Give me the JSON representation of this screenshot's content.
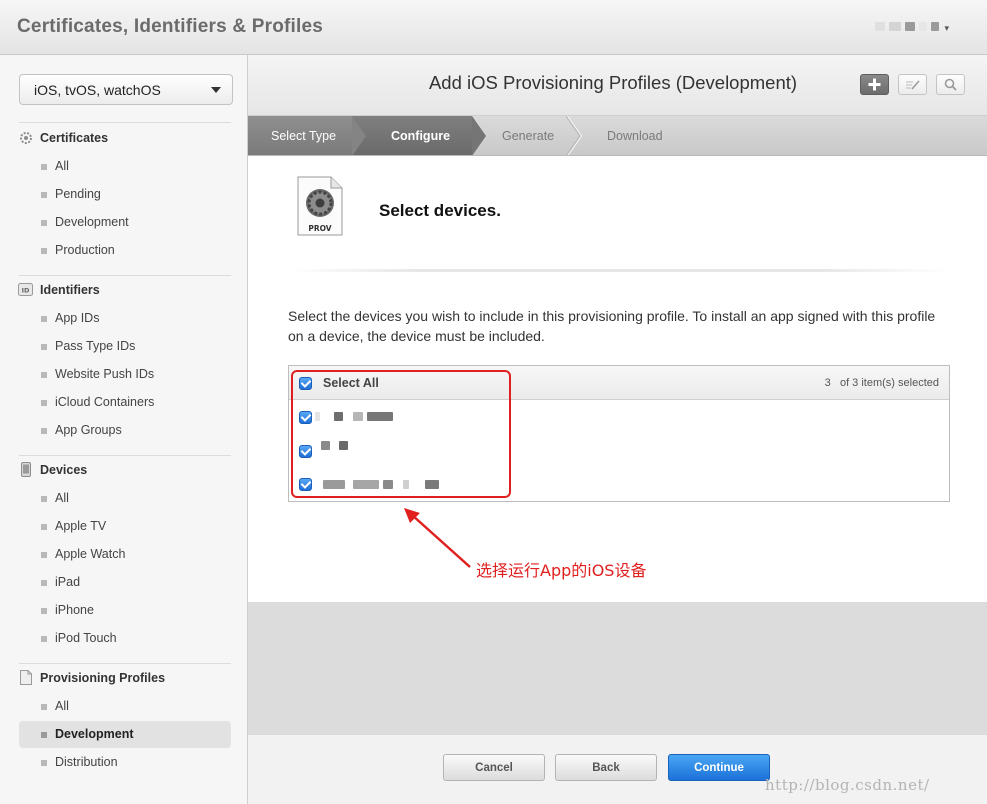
{
  "header": {
    "title": "Certificates, Identifiers & Profiles",
    "account_caret": "▾"
  },
  "sidebar": {
    "platform": "iOS, tvOS, watchOS",
    "sections": [
      {
        "title": "Certificates",
        "icon": "gear-icon",
        "items": [
          "All",
          "Pending",
          "Development",
          "Production"
        ]
      },
      {
        "title": "Identifiers",
        "icon": "id-icon",
        "items": [
          "App IDs",
          "Pass Type IDs",
          "Website Push IDs",
          "iCloud Containers",
          "App Groups"
        ]
      },
      {
        "title": "Devices",
        "icon": "device-icon",
        "items": [
          "All",
          "Apple TV",
          "Apple Watch",
          "iPad",
          "iPhone",
          "iPod Touch"
        ]
      },
      {
        "title": "Provisioning Profiles",
        "icon": "document-icon",
        "items": [
          "All",
          "Development",
          "Distribution"
        ]
      }
    ],
    "active_item": "Development"
  },
  "main": {
    "heading": "Add iOS Provisioning Profiles (Development)",
    "steps": [
      {
        "label": "Select Type",
        "state": "done"
      },
      {
        "label": "Configure",
        "state": "current"
      },
      {
        "label": "Generate",
        "state": "todo"
      },
      {
        "label": "Download",
        "state": "todo"
      }
    ],
    "prov_icon_label": "PROV",
    "section_title": "Select devices.",
    "instructions": "Select the devices you wish to include in this provisioning profile. To install an app signed with this profile on a device, the device must be included.",
    "table": {
      "select_all_label": "Select All",
      "selected_count": "3",
      "selected_suffix": "of 3 item(s) selected",
      "rows": [
        {
          "checked": true
        },
        {
          "checked": true
        },
        {
          "checked": true
        }
      ]
    },
    "annotation": "选择运行App的iOS设备",
    "buttons": {
      "cancel": "Cancel",
      "back": "Back",
      "continue": "Continue"
    }
  },
  "watermark": "http://blog.csdn.net/",
  "colors": {
    "accent_blue": "#1b71d8",
    "annotation_red": "#e0201f"
  }
}
